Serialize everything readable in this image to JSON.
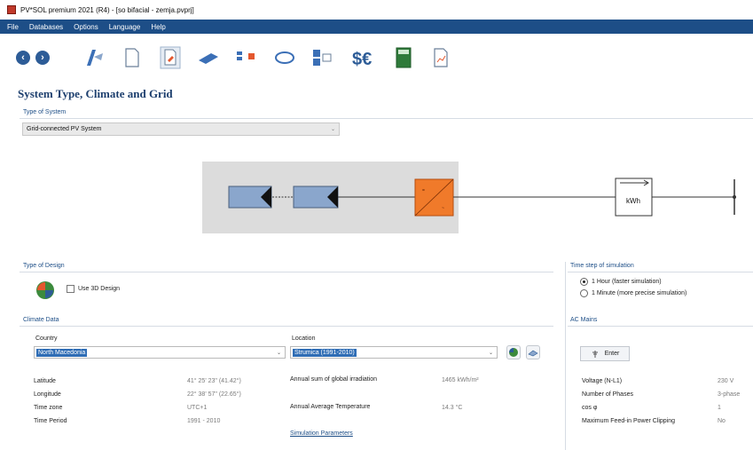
{
  "window": {
    "title": "PV*SOL premium 2021 (R4) - [so bifacial - zemja.pvprj]"
  },
  "menu": {
    "items": [
      "File",
      "Databases",
      "Options",
      "Language",
      "Help"
    ]
  },
  "page": {
    "title": "System Type, Climate and Grid"
  },
  "type_of_system": {
    "section_label": "Type of System",
    "selected": "Grid-connected PV System"
  },
  "diagram": {
    "meter_label": "kWh",
    "inverter_top": "=",
    "inverter_bottom": "~"
  },
  "type_of_design": {
    "section_label": "Type of Design",
    "use_3d_label": "Use 3D Design"
  },
  "timestep": {
    "section_label": "Time step of simulation",
    "options": [
      "1 Hour (faster simulation)",
      "1 Minute (more precise simulation)"
    ],
    "selected_index": 0
  },
  "climate": {
    "section_label": "Climate Data",
    "country_label": "Country",
    "country_value": "North Macedonia",
    "location_label": "Location",
    "location_value": "Strumica (1991-2010)",
    "rows": [
      {
        "label": "Latitude",
        "value": "41° 25' 23\"  (41.42°)"
      },
      {
        "label": "Longitude",
        "value": "22° 38' 57\"  (22.65°)"
      },
      {
        "label": "Time zone",
        "value": "UTC+1"
      },
      {
        "label": "Time Period",
        "value": "1991 - 2010"
      }
    ],
    "irradiation_label": "Annual sum of global irradiation",
    "irradiation_value": "1465 kWh/m²",
    "temperature_label": "Annual Average Temperature",
    "temperature_value": "14.3 °C",
    "sim_params_link": "Simulation Parameters"
  },
  "ac_mains": {
    "section_label": "AC Mains",
    "enter_label": "Enter",
    "rows": [
      {
        "label": "Voltage (N-L1)",
        "value": "230 V"
      },
      {
        "label": "Number of Phases",
        "value": "3-phase"
      },
      {
        "label": "cos φ",
        "value": "1"
      },
      {
        "label": "Maximum Feed-in Power Clipping",
        "value": "No"
      }
    ]
  },
  "colors": {
    "accent": "#1d4e87",
    "inverter": "#f07a2a",
    "module": "#8aa6cc"
  }
}
